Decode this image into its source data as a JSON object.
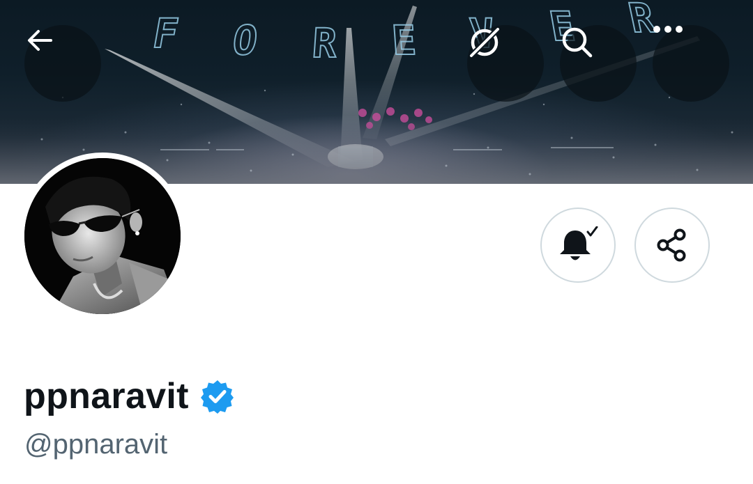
{
  "banner": {
    "text_letters": [
      "F",
      "O",
      "R",
      "E",
      "V",
      "E",
      "R"
    ]
  },
  "header": {
    "back_icon": "arrow-left-icon",
    "grok_icon": "grok-icon",
    "search_icon": "search-icon",
    "more_icon": "more-horizontal-icon"
  },
  "profile": {
    "display_name": "ppnaravit",
    "handle": "@ppnaravit",
    "verified": true,
    "verified_color": "#1d9bf0",
    "notify_icon": "bell-check-icon",
    "share_icon": "share-icon"
  }
}
